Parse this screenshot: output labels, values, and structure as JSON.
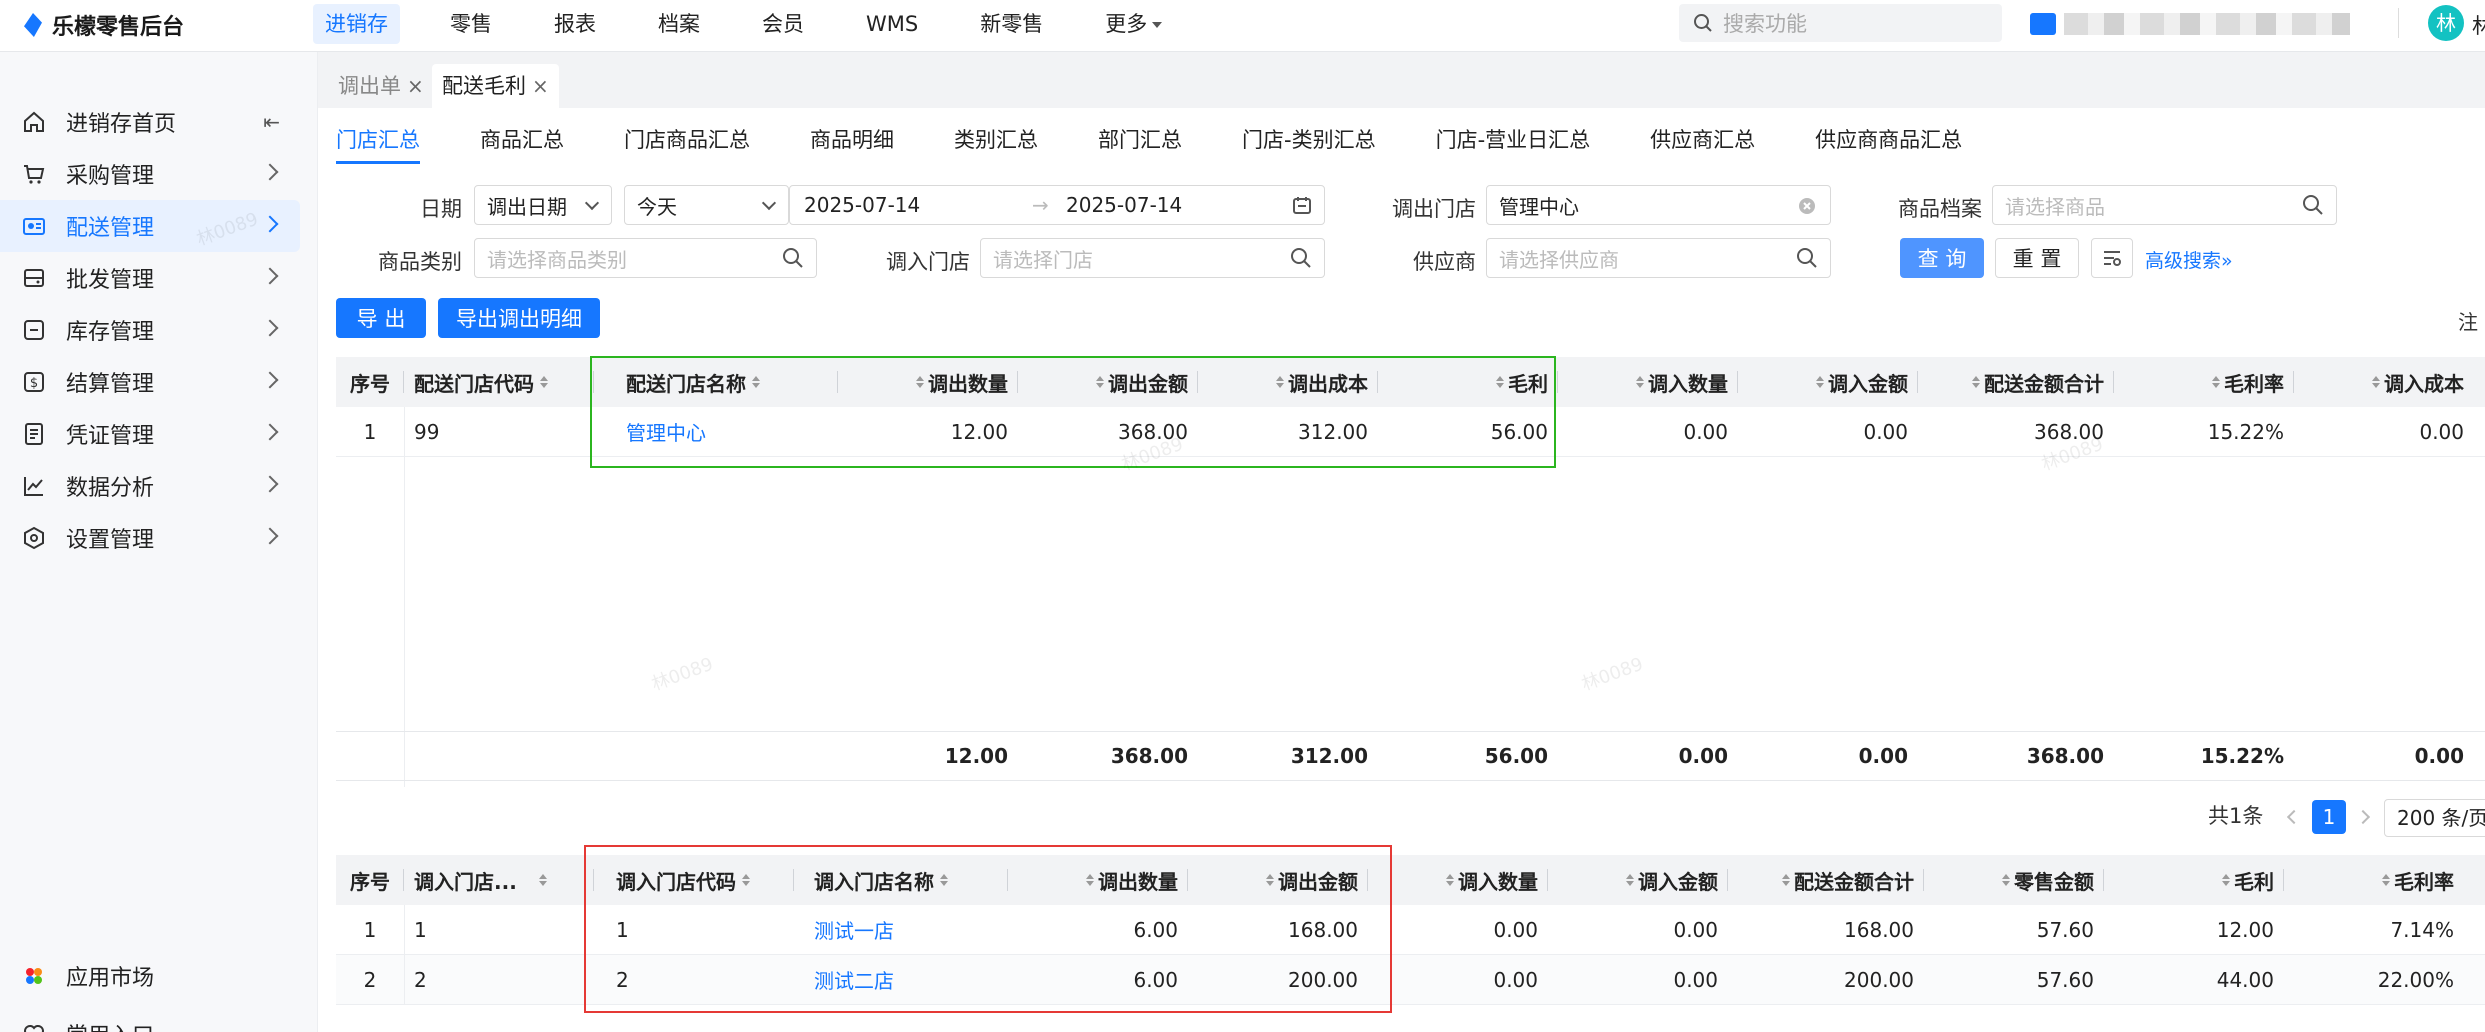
{
  "app": {
    "title": "乐檬零售后台",
    "user_initial": "林",
    "user_name_partial": "林"
  },
  "topnav": [
    {
      "label": "进销存",
      "active": true
    },
    {
      "label": "零售"
    },
    {
      "label": "报表"
    },
    {
      "label": "档案"
    },
    {
      "label": "会员"
    },
    {
      "label": "WMS"
    },
    {
      "label": "新零售"
    },
    {
      "label": "更多"
    }
  ],
  "search": {
    "placeholder": "搜索功能"
  },
  "sidebar": {
    "items": [
      {
        "label": "进销存首页",
        "icon": "home-icon"
      },
      {
        "label": "采购管理",
        "icon": "cart-icon"
      },
      {
        "label": "配送管理",
        "icon": "delivery-icon",
        "active": true
      },
      {
        "label": "批发管理",
        "icon": "wholesale-icon"
      },
      {
        "label": "库存管理",
        "icon": "inventory-icon"
      },
      {
        "label": "结算管理",
        "icon": "settlement-icon"
      },
      {
        "label": "凭证管理",
        "icon": "voucher-icon"
      },
      {
        "label": "数据分析",
        "icon": "chart-icon"
      },
      {
        "label": "设置管理",
        "icon": "settings-icon"
      }
    ],
    "bottom": [
      {
        "label": "应用市场",
        "icon": "app-market-icon"
      },
      {
        "label": "常用入口",
        "icon": "heart-icon"
      }
    ]
  },
  "page_tabs": [
    {
      "label": "调出单",
      "close": "×"
    },
    {
      "label": "配送毛利",
      "close": "×",
      "active": true
    }
  ],
  "sub_tabs": [
    "门店汇总",
    "商品汇总",
    "门店商品汇总",
    "商品明细",
    "类别汇总",
    "部门汇总",
    "门店-类别汇总",
    "门店-营业日汇总",
    "供应商汇总",
    "供应商商品汇总"
  ],
  "filters": {
    "date_label": "日期",
    "date_type": "调出日期",
    "date_range": "今天",
    "date_start": "2025-07-14",
    "date_end": "2025-07-14",
    "out_store_label": "调出门店",
    "out_store_value": "管理中心",
    "product_label": "商品档案",
    "product_placeholder": "请选择商品",
    "category_label": "商品类别",
    "category_placeholder": "请选择商品类别",
    "in_store_label": "调入门店",
    "in_store_placeholder": "请选择门店",
    "supplier_label": "供应商",
    "supplier_placeholder": "请选择供应商",
    "query_button": "查 询",
    "reset_button": "重 置",
    "advanced": "高级搜索"
  },
  "actions": {
    "export": "导 出",
    "export_detail": "导出调出明细",
    "note_edge": "注"
  },
  "table1": {
    "headers": [
      "序号",
      "配送门店代码",
      "配送门店名称",
      "调出数量",
      "调出金额",
      "调出成本",
      "毛利",
      "调入数量",
      "调入金额",
      "配送金额合计",
      "毛利率",
      "调入成本"
    ],
    "rows": [
      [
        "1",
        "99",
        "管理中心",
        "12.00",
        "368.00",
        "312.00",
        "56.00",
        "0.00",
        "0.00",
        "368.00",
        "15.22%",
        "0.00"
      ]
    ],
    "summary": [
      "12.00",
      "368.00",
      "312.00",
      "56.00",
      "0.00",
      "0.00",
      "368.00",
      "15.22%",
      "0.00"
    ]
  },
  "pagination": {
    "total": "共1条",
    "page": "1",
    "page_size": "200 条/页"
  },
  "table2": {
    "headers": [
      "序号",
      "调入门店...",
      "调入门店代码",
      "调入门店名称",
      "调出数量",
      "调出金额",
      "调入数量",
      "调入金额",
      "配送金额合计",
      "零售金额",
      "毛利",
      "毛利率"
    ],
    "rows": [
      [
        "1",
        "1",
        "1",
        "测试一店",
        "6.00",
        "168.00",
        "0.00",
        "0.00",
        "168.00",
        "57.60",
        "12.00",
        "7.14%"
      ],
      [
        "2",
        "2",
        "2",
        "测试二店",
        "6.00",
        "200.00",
        "0.00",
        "0.00",
        "200.00",
        "57.60",
        "44.00",
        "22.00%"
      ]
    ]
  },
  "watermark": "林0089",
  "colors": {
    "accent": "#1677ff",
    "highlight_green": "#2bb51f",
    "highlight_red": "#e53935",
    "avatar": "#13c2c2"
  }
}
